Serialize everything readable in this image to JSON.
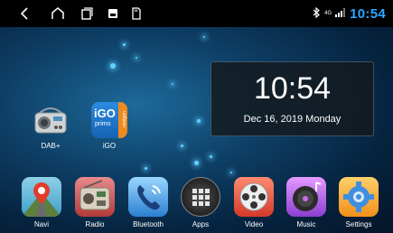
{
  "status_bar": {
    "clock": "10:54",
    "network": "4G",
    "nav_icons": [
      "back-icon",
      "home-icon",
      "recents-icon",
      "screenshot-icon",
      "sd-card-icon"
    ]
  },
  "clock_widget": {
    "time": "10:54",
    "date": "Dec 16, 2019  Monday"
  },
  "desktop_apps": [
    {
      "label": "DAB+",
      "icon": "radio-icon"
    },
    {
      "label": "iGO",
      "icon": "igo-icon",
      "logo_text": [
        "iGO",
        "primo",
        "nextgen"
      ]
    }
  ],
  "dock": [
    {
      "label": "Navi",
      "icon": "navi-icon"
    },
    {
      "label": "Radio",
      "icon": "radio-icon"
    },
    {
      "label": "Bluetooth",
      "icon": "bluetooth-phone-icon"
    },
    {
      "label": "Apps",
      "icon": "apps-grid-icon"
    },
    {
      "label": "Video",
      "icon": "video-reel-icon"
    },
    {
      "label": "Music",
      "icon": "music-disc-icon"
    },
    {
      "label": "Settings",
      "icon": "settings-gear-icon"
    }
  ],
  "colors": {
    "accent": "#2ba8ff",
    "statusbar": "#000000",
    "wallpaper": "#0e3f66"
  }
}
